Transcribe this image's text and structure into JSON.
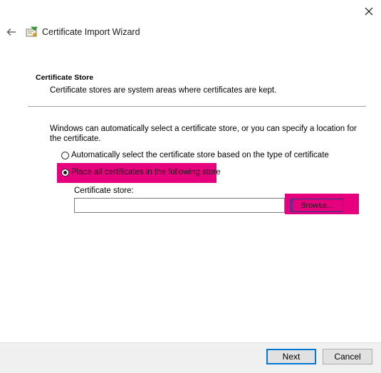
{
  "window": {
    "title": "Certificate Import Wizard",
    "close_icon": "close-icon",
    "back_icon": "back-arrow-icon",
    "wizard_icon": "certificate-icon"
  },
  "section": {
    "title": "Certificate Store",
    "description": "Certificate stores are system areas where certificates are kept."
  },
  "intro": "Windows can automatically select a certificate store, or you can specify a location for the certificate.",
  "options": {
    "auto_label": "Automatically select the certificate store based on the type of certificate",
    "auto_selected": false,
    "manual_label": "Place all certificates in the following store",
    "manual_selected": true
  },
  "store": {
    "label": "Certificate store:",
    "value": "",
    "browse_label": "Browse..."
  },
  "footer": {
    "next_label": "Next",
    "cancel_label": "Cancel"
  },
  "colors": {
    "highlight": "#e6007e",
    "focus": "#0078d7"
  }
}
